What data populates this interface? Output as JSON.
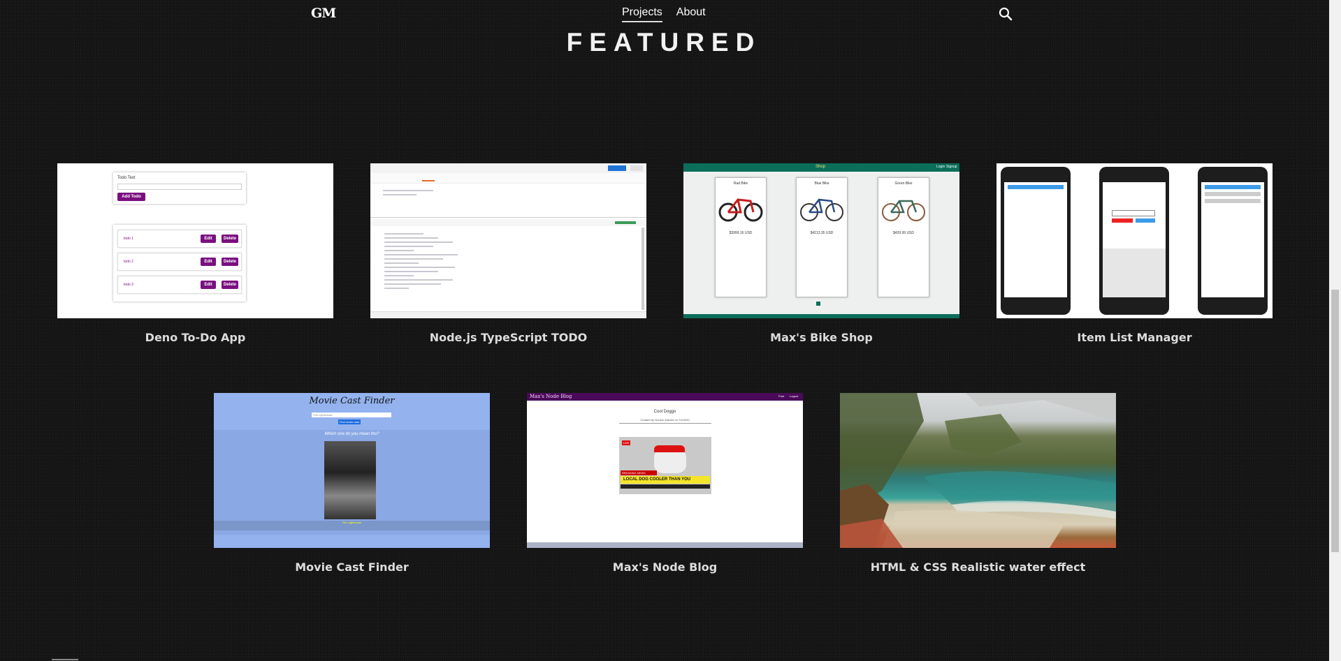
{
  "header": {
    "logo_text": "GM",
    "nav": [
      {
        "label": "Projects",
        "active": true
      },
      {
        "label": "About",
        "active": false
      }
    ],
    "search_icon": "search-icon"
  },
  "page_title": "FEATURED",
  "projects": [
    {
      "title": "Deno To-Do App",
      "thumb": {
        "heading": "Todo Text",
        "add_button": "Add Todo",
        "items": [
          "todo 1",
          "todo 2",
          "todo 3"
        ],
        "edit_label": "Edit",
        "delete_label": "Delete"
      }
    },
    {
      "title": "Node.js TypeScript TODO"
    },
    {
      "title": "Max's Bike Shop",
      "thumb": {
        "brand": "Shop",
        "login": "Login",
        "signup": "Signup",
        "bikes": [
          {
            "name": "Rad Bike",
            "price": "$3999.16 USD"
          },
          {
            "name": "Blue Bike",
            "price": "$4213.35 USD"
          },
          {
            "name": "Green Bike",
            "price": "$439.99 USD"
          }
        ]
      }
    },
    {
      "title": "Item List Manager"
    },
    {
      "title": "Movie Cast Finder",
      "thumb": {
        "heading": "Movie Cast Finder",
        "input_placeholder": "The Lighthouse",
        "submit": "Find movie cast",
        "question": "Which one do you mean tho?",
        "movie": "The Lighthouse"
      }
    },
    {
      "title": "Max's Node Blog",
      "thumb": {
        "brand": "Max's Node Blog",
        "links": [
          "Post",
          "Logout"
        ],
        "post_title": "Cool Doggo",
        "post_by": "Created by Gordon Maxina on 7/4/2020",
        "breaking": "BREAKING NEWS",
        "headline": "LOCAL DOG COOLER THAN YOU",
        "live": "LIVE"
      }
    },
    {
      "title": "HTML & CSS Realistic water effect"
    }
  ],
  "colors": {
    "background": "#141414",
    "todo_purple": "#7a1080",
    "bike_header": "#0b6e5a",
    "movie_bg": "#93b2ee",
    "blog_header": "#4a0a5a"
  }
}
